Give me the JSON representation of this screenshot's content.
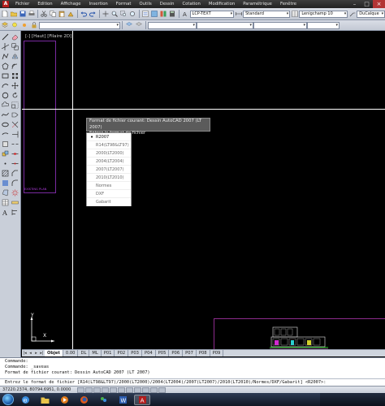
{
  "menubar": {
    "items": [
      "Fichier",
      "Edition",
      "Affichage",
      "Insertion",
      "Format",
      "Outils",
      "Dessin",
      "Cotation",
      "Modification",
      "Paramétrique",
      "Fenêtre"
    ]
  },
  "toolbar": {
    "text_style": "LCP-TEXT",
    "dim_style": "Standard",
    "table_style": "Lenigchamp 10",
    "annotative": "DuCalque"
  },
  "viewport": {
    "label": "[-] [Haut] [Filaire 2D]"
  },
  "drawing": {
    "frame_label": "EXISTING PLAN"
  },
  "prompt": {
    "line1": "Format de fichier courant: Dessin AutoCAD 2007 (LT 2007)",
    "line2": "Entrez le format de fichier"
  },
  "options": {
    "items": [
      "R2007",
      "R14(LT98&LT97)",
      "2000(LT2000)",
      "2004(LT2004)",
      "2007(LT2007)",
      "2010(LT2010)",
      "Normes",
      "DXF",
      "Gabarit"
    ],
    "selected": "R2007"
  },
  "tabs": {
    "items": [
      "Objet",
      "0.00",
      "DL",
      "ML",
      "P01",
      "P02",
      "P03",
      "P04",
      "P05",
      "P06",
      "P07",
      "P08",
      "P09"
    ],
    "active": "Objet"
  },
  "commandline": {
    "history": [
      "Commande:",
      "Commande: _saveas",
      "Format de fichier courant: Dessin AutoCAD 2007 (LT 2007)"
    ],
    "input": "Entrez le format de fichier [R14(LT98&LT97)/2000(LT2000)/2004(LT2004)/2007(LT2007)/2010(LT2010)/Normes/DXF/Gabarit] <R2007>:"
  },
  "statusbar": {
    "coords": "37220.2374, 80794.6951, 0.0000"
  },
  "colors": {
    "menubar": "#2b2b2b",
    "canvas": "#000000",
    "crosshair": "#ffffff",
    "frame": "#7a2aa0",
    "selection": "#000000"
  }
}
